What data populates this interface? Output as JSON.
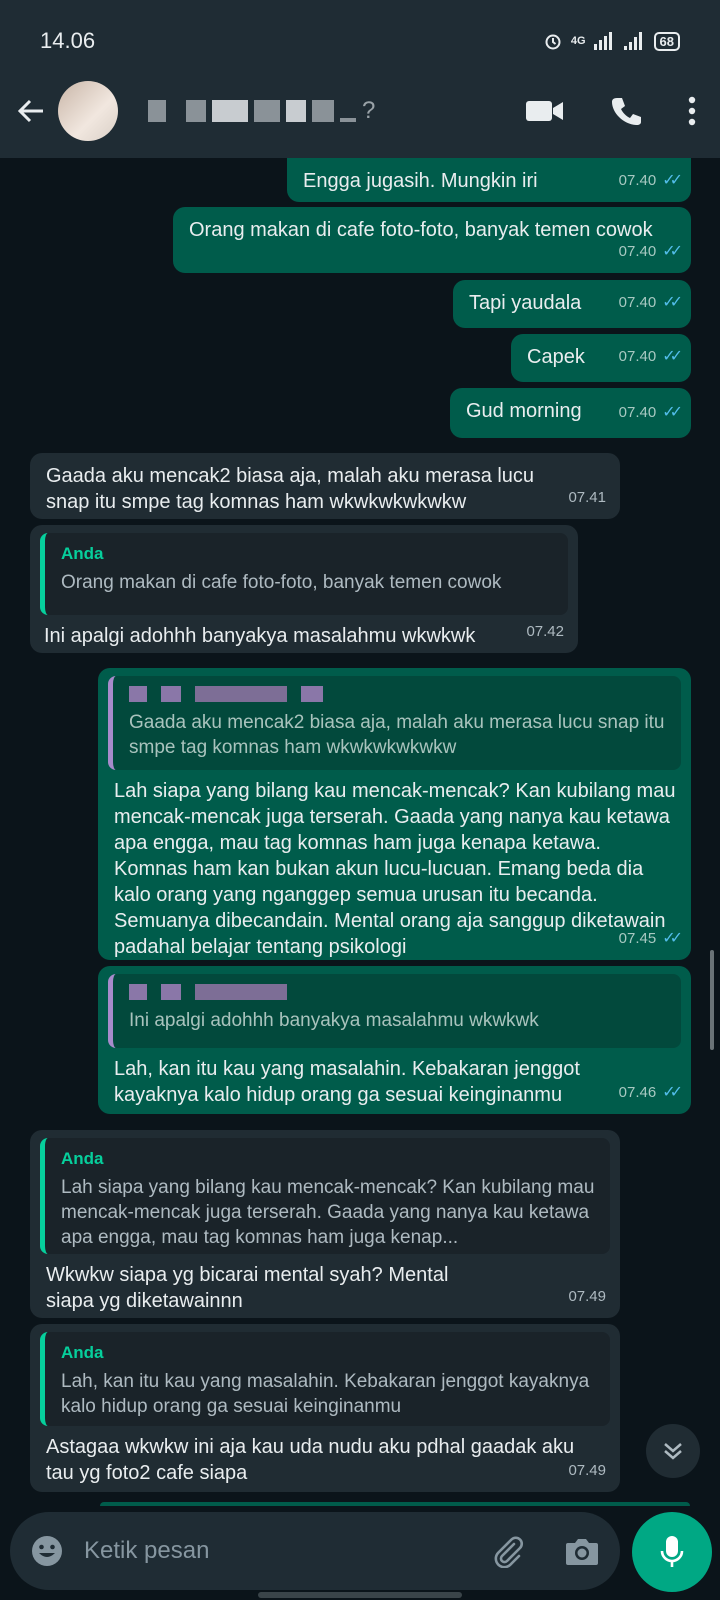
{
  "status_bar": {
    "time": "14.06",
    "network": "4G",
    "battery": "68"
  },
  "header": {
    "title_suffix": "?"
  },
  "messages": [
    {
      "dir": "out",
      "text": "Engga jugasih. Mungkin iri",
      "time": "07.40"
    },
    {
      "dir": "out",
      "text": "Orang makan di cafe foto-foto, banyak temen cowok",
      "time": "07.40"
    },
    {
      "dir": "out",
      "text": "Tapi yaudala",
      "time": "07.40"
    },
    {
      "dir": "out",
      "text": "Capek",
      "time": "07.40"
    },
    {
      "dir": "out",
      "text": "Gud morning",
      "time": "07.40"
    },
    {
      "dir": "in",
      "text": "Gaada aku mencak2 biasa aja, malah aku merasa lucu snap itu smpe tag komnas ham wkwkwkwkwkw",
      "time": "07.41"
    },
    {
      "dir": "in",
      "quote_author": "Anda",
      "quote_text": "Orang makan di cafe foto-foto, banyak temen cowok",
      "text": "Ini apalgi adohhh banyakya masalahmu wkwkwk",
      "time": "07.42"
    },
    {
      "dir": "out",
      "quote_text": "Gaada aku mencak2 biasa aja, malah aku merasa lucu snap itu smpe tag komnas ham wkwkwkwkwkw",
      "text": "Lah siapa yang bilang kau mencak-mencak? Kan kubilang mau mencak-mencak juga terserah. Gaada yang nanya kau ketawa apa engga, mau tag komnas ham juga kenapa ketawa. Komnas ham kan bukan akun lucu-lucuan. Emang beda dia kalo orang yang nganggep semua urusan itu becanda. Semuanya dibecandain. Mental orang aja sanggup diketawain padahal belajar tentang psikologi",
      "time": "07.45"
    },
    {
      "dir": "out",
      "quote_text": "Ini apalgi adohhh banyakya masalahmu wkwkwk",
      "text": "Lah, kan itu kau yang masalahin. Kebakaran jenggot kayaknya kalo hidup orang ga sesuai keinginanmu",
      "time": "07.46"
    },
    {
      "dir": "in",
      "quote_author": "Anda",
      "quote_text": "Lah siapa yang bilang kau mencak-mencak? Kan kubilang mau mencak-mencak juga terserah. Gaada yang nanya kau ketawa apa engga, mau tag komnas ham juga kenap...",
      "text": "Wkwkw siapa yg bicarai mental syah? Mental siapa yg diketawainnn",
      "time": "07.49"
    },
    {
      "dir": "in",
      "quote_author": "Anda",
      "quote_text": "Lah, kan itu kau yang masalahin. Kebakaran jenggot kayaknya kalo hidup orang ga sesuai keinginanmu",
      "text": "Astagaa wkwkw ini aja kau uda nudu aku pdhal gaadak aku tau yg foto2 cafe siapa",
      "time": "07.49"
    }
  ],
  "input": {
    "placeholder": "Ketik pesan"
  },
  "colors": {
    "accent": "#00a884",
    "outgoing": "#005c4b",
    "incoming": "#202c33",
    "read_ticks": "#53bdeb"
  },
  "icons": [
    "back-arrow-icon",
    "video-call-icon",
    "phone-icon",
    "more-vert-icon",
    "emoji-icon",
    "attach-icon",
    "camera-icon",
    "mic-icon",
    "double-chevron-down-icon",
    "alarm-icon",
    "signal-icon"
  ]
}
